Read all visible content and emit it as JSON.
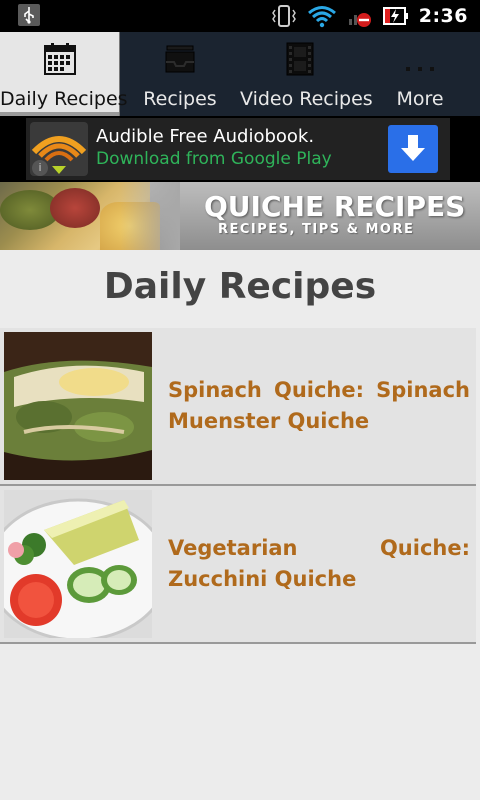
{
  "status_bar": {
    "time": "2:36"
  },
  "tabs": [
    {
      "label": "Daily Recipes",
      "icon": "calendar-icon",
      "active": true
    },
    {
      "label": "Recipes",
      "icon": "inbox-tray-icon",
      "active": false
    },
    {
      "label": "Video Recipes",
      "icon": "film-strip-icon",
      "active": false
    },
    {
      "label": "More",
      "icon": "more-dots-icon",
      "active": false
    }
  ],
  "ad": {
    "title": "Audible Free Audiobook.",
    "subtitle": "Download from Google Play",
    "info": "i"
  },
  "header": {
    "title": "QUICHE RECIPES",
    "subtitle": "RECIPES, TIPS & MORE"
  },
  "page": {
    "title": "Daily Recipes"
  },
  "recipes": [
    {
      "title": "Spinach Quiche: Spinach Muenster Quiche"
    },
    {
      "title": "Vegetarian Quiche: Zucchini Quiche"
    }
  ],
  "colors": {
    "accent_text": "#b06a1c",
    "tab_bg": "#1b2430",
    "active_tab_bg": "#e6e6e6",
    "ad_subtitle": "#2fb45a",
    "download_button": "#2a6fe8"
  }
}
